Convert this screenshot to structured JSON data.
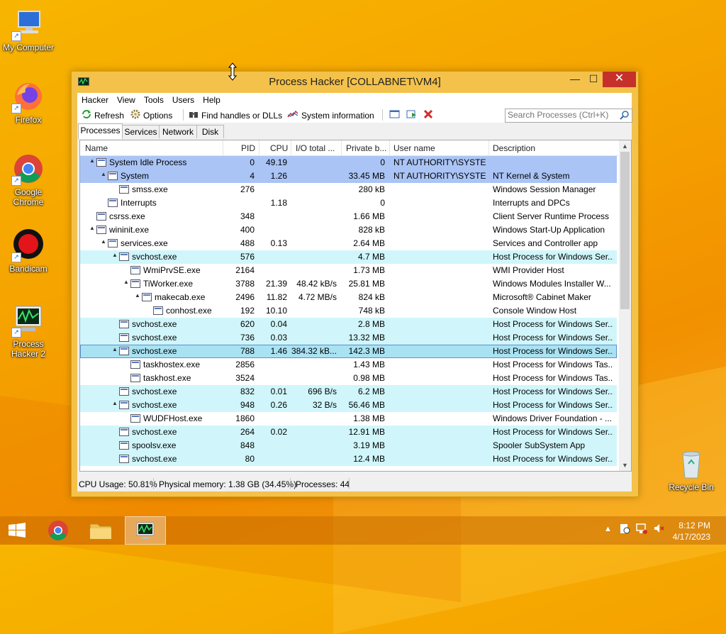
{
  "desktop": {
    "icons": [
      {
        "label": "My Computer"
      },
      {
        "label": "Firefox"
      },
      {
        "label": "Google Chrome"
      },
      {
        "label": "Bandicam"
      },
      {
        "label": "Process Hacker 2"
      },
      {
        "label": "Recycle Bin"
      }
    ]
  },
  "window": {
    "title": "Process Hacker [COLLABNET\\VM4]",
    "min": "—",
    "max": "☐",
    "close": "✕"
  },
  "menu": [
    "Hacker",
    "View",
    "Tools",
    "Users",
    "Help"
  ],
  "toolbar": {
    "refresh": "Refresh",
    "options": "Options",
    "find": "Find handles or DLLs",
    "sysinfo": "System information",
    "search_placeholder": "Search Processes (Ctrl+K)"
  },
  "tabs": [
    "Processes",
    "Services",
    "Network",
    "Disk"
  ],
  "columns": [
    "Name",
    "PID",
    "CPU",
    "I/O total ...",
    "Private b...",
    "User name",
    "Description"
  ],
  "rows": [
    {
      "depth": 0,
      "tw": "▲",
      "name": "System Idle Process",
      "pid": "0",
      "cpu": "49.19",
      "io": "",
      "priv": "0",
      "user": "NT AUTHORITY\\SYSTEM",
      "desc": "",
      "bg": "#aac4f5"
    },
    {
      "depth": 1,
      "tw": "▲",
      "name": "System",
      "pid": "4",
      "cpu": "1.26",
      "io": "",
      "priv": "33.45 MB",
      "user": "NT AUTHORITY\\SYSTEM",
      "desc": "NT Kernel & System",
      "bg": "#aac4f5"
    },
    {
      "depth": 2,
      "tw": "",
      "name": "smss.exe",
      "pid": "276",
      "cpu": "",
      "io": "",
      "priv": "280 kB",
      "user": "",
      "desc": "Windows Session Manager",
      "bg": ""
    },
    {
      "depth": 1,
      "tw": "",
      "name": "Interrupts",
      "pid": "",
      "cpu": "1.18",
      "io": "",
      "priv": "0",
      "user": "",
      "desc": "Interrupts and DPCs",
      "bg": ""
    },
    {
      "depth": 0,
      "tw": "",
      "name": "csrss.exe",
      "pid": "348",
      "cpu": "",
      "io": "",
      "priv": "1.66 MB",
      "user": "",
      "desc": "Client Server Runtime Process",
      "bg": ""
    },
    {
      "depth": 0,
      "tw": "▲",
      "name": "wininit.exe",
      "pid": "400",
      "cpu": "",
      "io": "",
      "priv": "828 kB",
      "user": "",
      "desc": "Windows Start-Up Application",
      "bg": ""
    },
    {
      "depth": 1,
      "tw": "▲",
      "name": "services.exe",
      "pid": "488",
      "cpu": "0.13",
      "io": "",
      "priv": "2.64 MB",
      "user": "",
      "desc": "Services and Controller app",
      "bg": ""
    },
    {
      "depth": 2,
      "tw": "▲",
      "name": "svchost.exe",
      "pid": "576",
      "cpu": "",
      "io": "",
      "priv": "4.7 MB",
      "user": "",
      "desc": "Host Process for Windows Ser...",
      "bg": "#d0f6fb"
    },
    {
      "depth": 3,
      "tw": "",
      "name": "WmiPrvSE.exe",
      "pid": "2164",
      "cpu": "",
      "io": "",
      "priv": "1.73 MB",
      "user": "",
      "desc": "WMI Provider Host",
      "bg": ""
    },
    {
      "depth": 3,
      "tw": "▲",
      "name": "TiWorker.exe",
      "pid": "3788",
      "cpu": "21.39",
      "io": "48.42 kB/s",
      "priv": "25.81 MB",
      "user": "",
      "desc": "Windows Modules Installer W...",
      "bg": ""
    },
    {
      "depth": 4,
      "tw": "▲",
      "name": "makecab.exe",
      "pid": "2496",
      "cpu": "11.82",
      "io": "4.72 MB/s",
      "priv": "824 kB",
      "user": "",
      "desc": "Microsoft® Cabinet Maker",
      "bg": ""
    },
    {
      "depth": 5,
      "tw": "",
      "name": "conhost.exe",
      "pid": "192",
      "cpu": "10.10",
      "io": "",
      "priv": "748 kB",
      "user": "",
      "desc": "Console Window Host",
      "bg": ""
    },
    {
      "depth": 2,
      "tw": "",
      "name": "svchost.exe",
      "pid": "620",
      "cpu": "0.04",
      "io": "",
      "priv": "2.8 MB",
      "user": "",
      "desc": "Host Process for Windows Ser...",
      "bg": "#d0f6fb"
    },
    {
      "depth": 2,
      "tw": "",
      "name": "svchost.exe",
      "pid": "736",
      "cpu": "0.03",
      "io": "",
      "priv": "13.32 MB",
      "user": "",
      "desc": "Host Process for Windows Ser...",
      "bg": "#d0f6fb"
    },
    {
      "depth": 2,
      "tw": "▲",
      "name": "svchost.exe",
      "pid": "788",
      "cpu": "1.46",
      "io": "384.32 kB...",
      "priv": "142.3 MB",
      "user": "",
      "desc": "Host Process for Windows Ser...",
      "bg": "#a9e3f3",
      "sel": true
    },
    {
      "depth": 3,
      "tw": "",
      "name": "taskhostex.exe",
      "pid": "2856",
      "cpu": "",
      "io": "",
      "priv": "1.43 MB",
      "user": "",
      "desc": "Host Process for Windows Tas...",
      "bg": ""
    },
    {
      "depth": 3,
      "tw": "",
      "name": "taskhost.exe",
      "pid": "3524",
      "cpu": "",
      "io": "",
      "priv": "0.98 MB",
      "user": "",
      "desc": "Host Process for Windows Tas...",
      "bg": ""
    },
    {
      "depth": 2,
      "tw": "",
      "name": "svchost.exe",
      "pid": "832",
      "cpu": "0.01",
      "io": "696 B/s",
      "priv": "6.2 MB",
      "user": "",
      "desc": "Host Process for Windows Ser...",
      "bg": "#d0f6fb"
    },
    {
      "depth": 2,
      "tw": "▲",
      "name": "svchost.exe",
      "pid": "948",
      "cpu": "0.26",
      "io": "32 B/s",
      "priv": "56.46 MB",
      "user": "",
      "desc": "Host Process for Windows Ser...",
      "bg": "#d0f6fb"
    },
    {
      "depth": 3,
      "tw": "",
      "name": "WUDFHost.exe",
      "pid": "1860",
      "cpu": "",
      "io": "",
      "priv": "1.38 MB",
      "user": "",
      "desc": "Windows Driver Foundation - ...",
      "bg": ""
    },
    {
      "depth": 2,
      "tw": "",
      "name": "svchost.exe",
      "pid": "264",
      "cpu": "0.02",
      "io": "",
      "priv": "12.91 MB",
      "user": "",
      "desc": "Host Process for Windows Ser...",
      "bg": "#d0f6fb"
    },
    {
      "depth": 2,
      "tw": "",
      "name": "spoolsv.exe",
      "pid": "848",
      "cpu": "",
      "io": "",
      "priv": "3.19 MB",
      "user": "",
      "desc": "Spooler SubSystem App",
      "bg": "#d0f6fb"
    },
    {
      "depth": 2,
      "tw": "",
      "name": "svchost.exe",
      "pid": "80",
      "cpu": "",
      "io": "",
      "priv": "12.4 MB",
      "user": "",
      "desc": "Host Process for Windows Ser...",
      "bg": "#d0f6fb"
    }
  ],
  "status": {
    "cpu": "CPU Usage: 50.81%",
    "mem": "Physical memory: 1.38 GB (34.45%)",
    "procs": "Processes: 44"
  },
  "taskbar": {
    "time": "8:12 PM",
    "date": "4/17/2023"
  }
}
